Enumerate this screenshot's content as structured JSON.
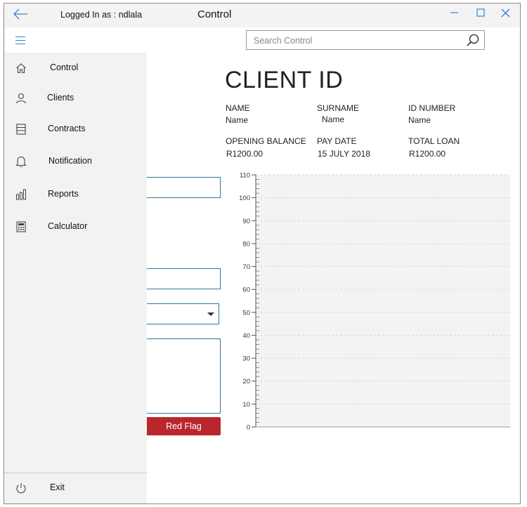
{
  "titlebar": {
    "logged_in": "Logged In as : ndlala",
    "title": "Control",
    "minimize": "—",
    "maximize": "☐",
    "close": "✕"
  },
  "search": {
    "placeholder": "Search Control"
  },
  "nav": {
    "items": [
      {
        "label": "Control",
        "icon": "home-icon"
      },
      {
        "label": "Clients",
        "icon": "person-icon"
      },
      {
        "label": "Contracts",
        "icon": "contracts-icon"
      },
      {
        "label": "Notification",
        "icon": "bell-icon"
      },
      {
        "label": "Reports",
        "icon": "bar-chart-icon"
      },
      {
        "label": "Calculator",
        "icon": "calculator-icon"
      }
    ],
    "exit": {
      "label": "Exit",
      "icon": "power-icon"
    }
  },
  "client": {
    "heading": "CLIENT ID",
    "name_label": "NAME",
    "name_value": "Name",
    "surname_label": "SURNAME",
    "surname_value": "Name",
    "id_label": "ID NUMBER",
    "id_value": "Name",
    "opening_label": "OPENING BALANCE",
    "opening_value": "R1200.00",
    "paydate_label": "PAY DATE",
    "paydate_value": "15 JULY 2018",
    "loan_label": "TOTAL LOAN",
    "loan_value": "R1200.00"
  },
  "form": {
    "red_flag": "Red Flag"
  },
  "chart_data": {
    "type": "bar",
    "categories": [],
    "series": [],
    "ylim": [
      0,
      110
    ],
    "yticks": [
      0,
      10,
      20,
      30,
      40,
      50,
      60,
      70,
      80,
      90,
      100,
      110
    ],
    "grid": true
  }
}
